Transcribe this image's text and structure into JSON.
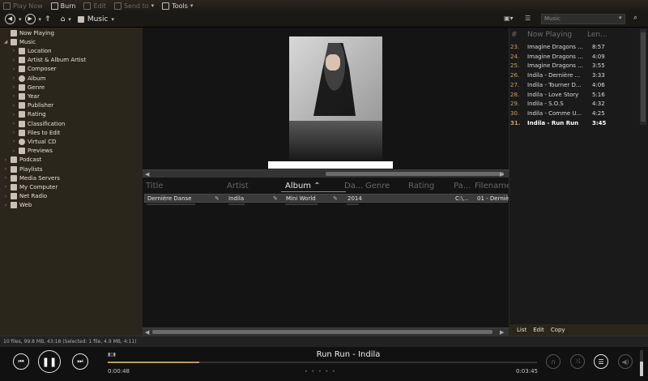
{
  "toolbar": {
    "items": [
      {
        "label": "Play Now",
        "dim": true
      },
      {
        "label": "Burn",
        "dim": false
      },
      {
        "label": "Edit",
        "dim": true
      },
      {
        "label": "Send to",
        "dim": true
      },
      {
        "label": "Tools",
        "dim": false
      }
    ]
  },
  "nav": {
    "location": "Music",
    "search_placeholder": "Music"
  },
  "tree": [
    {
      "label": "Now Playing",
      "level": 0
    },
    {
      "label": "Music",
      "level": 0
    },
    {
      "label": "Location",
      "level": 1
    },
    {
      "label": "Artist & Album Artist",
      "level": 1
    },
    {
      "label": "Composer",
      "level": 1
    },
    {
      "label": "Album",
      "level": 1
    },
    {
      "label": "Genre",
      "level": 1
    },
    {
      "label": "Year",
      "level": 1
    },
    {
      "label": "Publisher",
      "level": 1
    },
    {
      "label": "Rating",
      "level": 1
    },
    {
      "label": "Classification",
      "level": 1
    },
    {
      "label": "Files to Edit",
      "level": 1
    },
    {
      "label": "Virtual CD",
      "level": 1
    },
    {
      "label": "Previews",
      "level": 1
    },
    {
      "label": "Podcast",
      "level": 0
    },
    {
      "label": "Playlists",
      "level": 0
    },
    {
      "label": "Media Servers",
      "level": 0
    },
    {
      "label": "My Computer",
      "level": 0
    },
    {
      "label": "Net Radio",
      "level": 0
    },
    {
      "label": "Web",
      "level": 0
    }
  ],
  "columns": [
    "Title",
    "Artist",
    "Album",
    "Da...",
    "Genre",
    "Rating",
    "Pa...",
    "Filename"
  ],
  "file_row": {
    "title": "Dernière Danse",
    "artist": "Indila",
    "album": "Mini World",
    "date": "2014",
    "path": "C:\\...",
    "filename": "01 - Dernière"
  },
  "now_playing": {
    "headers": [
      "#",
      "Now Playing",
      "Len..."
    ],
    "rows": [
      {
        "num": "23.",
        "title": "Imagine Dragons ...",
        "len": "8:57"
      },
      {
        "num": "24.",
        "title": "Imagine Dragons ...",
        "len": "4:09"
      },
      {
        "num": "25.",
        "title": "Imagine Dragons ...",
        "len": "3:55"
      },
      {
        "num": "26.",
        "title": "Indila - Dernière ...",
        "len": "3:33"
      },
      {
        "num": "27.",
        "title": "Indila - Tourner D...",
        "len": "4:06"
      },
      {
        "num": "28.",
        "title": "Indila - Love Story",
        "len": "5:16"
      },
      {
        "num": "29.",
        "title": "Indila - S.O.S",
        "len": "4:32"
      },
      {
        "num": "30.",
        "title": "Indila - Comme U...",
        "len": "4:25"
      },
      {
        "num": "31.",
        "title": "Indila - Run Run",
        "len": "3:45"
      }
    ],
    "footer": [
      "List",
      "Edit",
      "Copy"
    ]
  },
  "status": "10 files, 99.8 MB, 43:18 (Selected: 1 file, 4.9 MB, 4:11)",
  "player": {
    "title": "Run Run - Indila",
    "elapsed": "0:00:48",
    "total": "0:03:45",
    "progress": 0.213
  }
}
